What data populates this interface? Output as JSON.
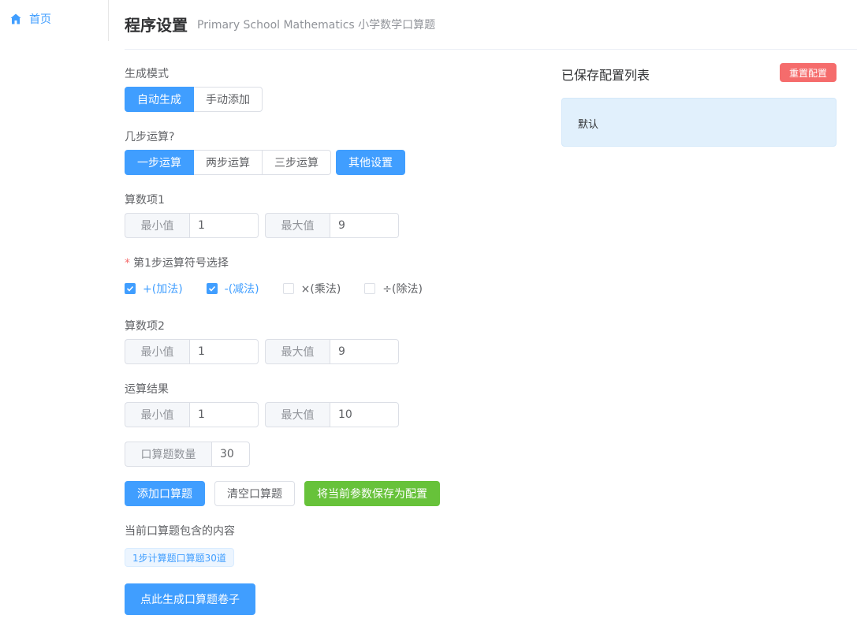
{
  "nav": {
    "home": "首页"
  },
  "header": {
    "title": "程序设置",
    "subtitle": "Primary School Mathematics 小学数学口算题"
  },
  "mode": {
    "label": "生成模式",
    "options": [
      "自动生成",
      "手动添加"
    ],
    "selected": "自动生成"
  },
  "steps": {
    "label": "几步运算?",
    "options": [
      "一步运算",
      "两步运算",
      "三步运算"
    ],
    "selected": "一步运算",
    "other_settings": "其他设置"
  },
  "operand1": {
    "label": "算数项1",
    "min_label": "最小值",
    "min": "1",
    "max_label": "最大值",
    "max": "9"
  },
  "operators": {
    "label": "第1步运算符号选择",
    "items": [
      {
        "label": "+(加法)",
        "checked": true
      },
      {
        "label": "-(减法)",
        "checked": true
      },
      {
        "label": "×(乘法)",
        "checked": false
      },
      {
        "label": "÷(除法)",
        "checked": false
      }
    ]
  },
  "operand2": {
    "label": "算数项2",
    "min_label": "最小值",
    "min": "1",
    "max_label": "最大值",
    "max": "9"
  },
  "result": {
    "label": "运算结果",
    "min_label": "最小值",
    "min": "1",
    "max_label": "最大值",
    "max": "10"
  },
  "count": {
    "label": "口算题数量",
    "value": "30"
  },
  "actions": {
    "add": "添加口算题",
    "clear": "清空口算题",
    "save": "将当前参数保存为配置"
  },
  "contents": {
    "label": "当前口算题包含的内容",
    "tag": "1步计算题口算题30道"
  },
  "generate": "点此生成口算题卷子",
  "saved": {
    "title": "已保存配置列表",
    "reset": "重置配置",
    "items": [
      "默认"
    ]
  },
  "colors": {
    "primary": "#409eff",
    "success": "#67c23a",
    "danger": "#f56c6c"
  }
}
